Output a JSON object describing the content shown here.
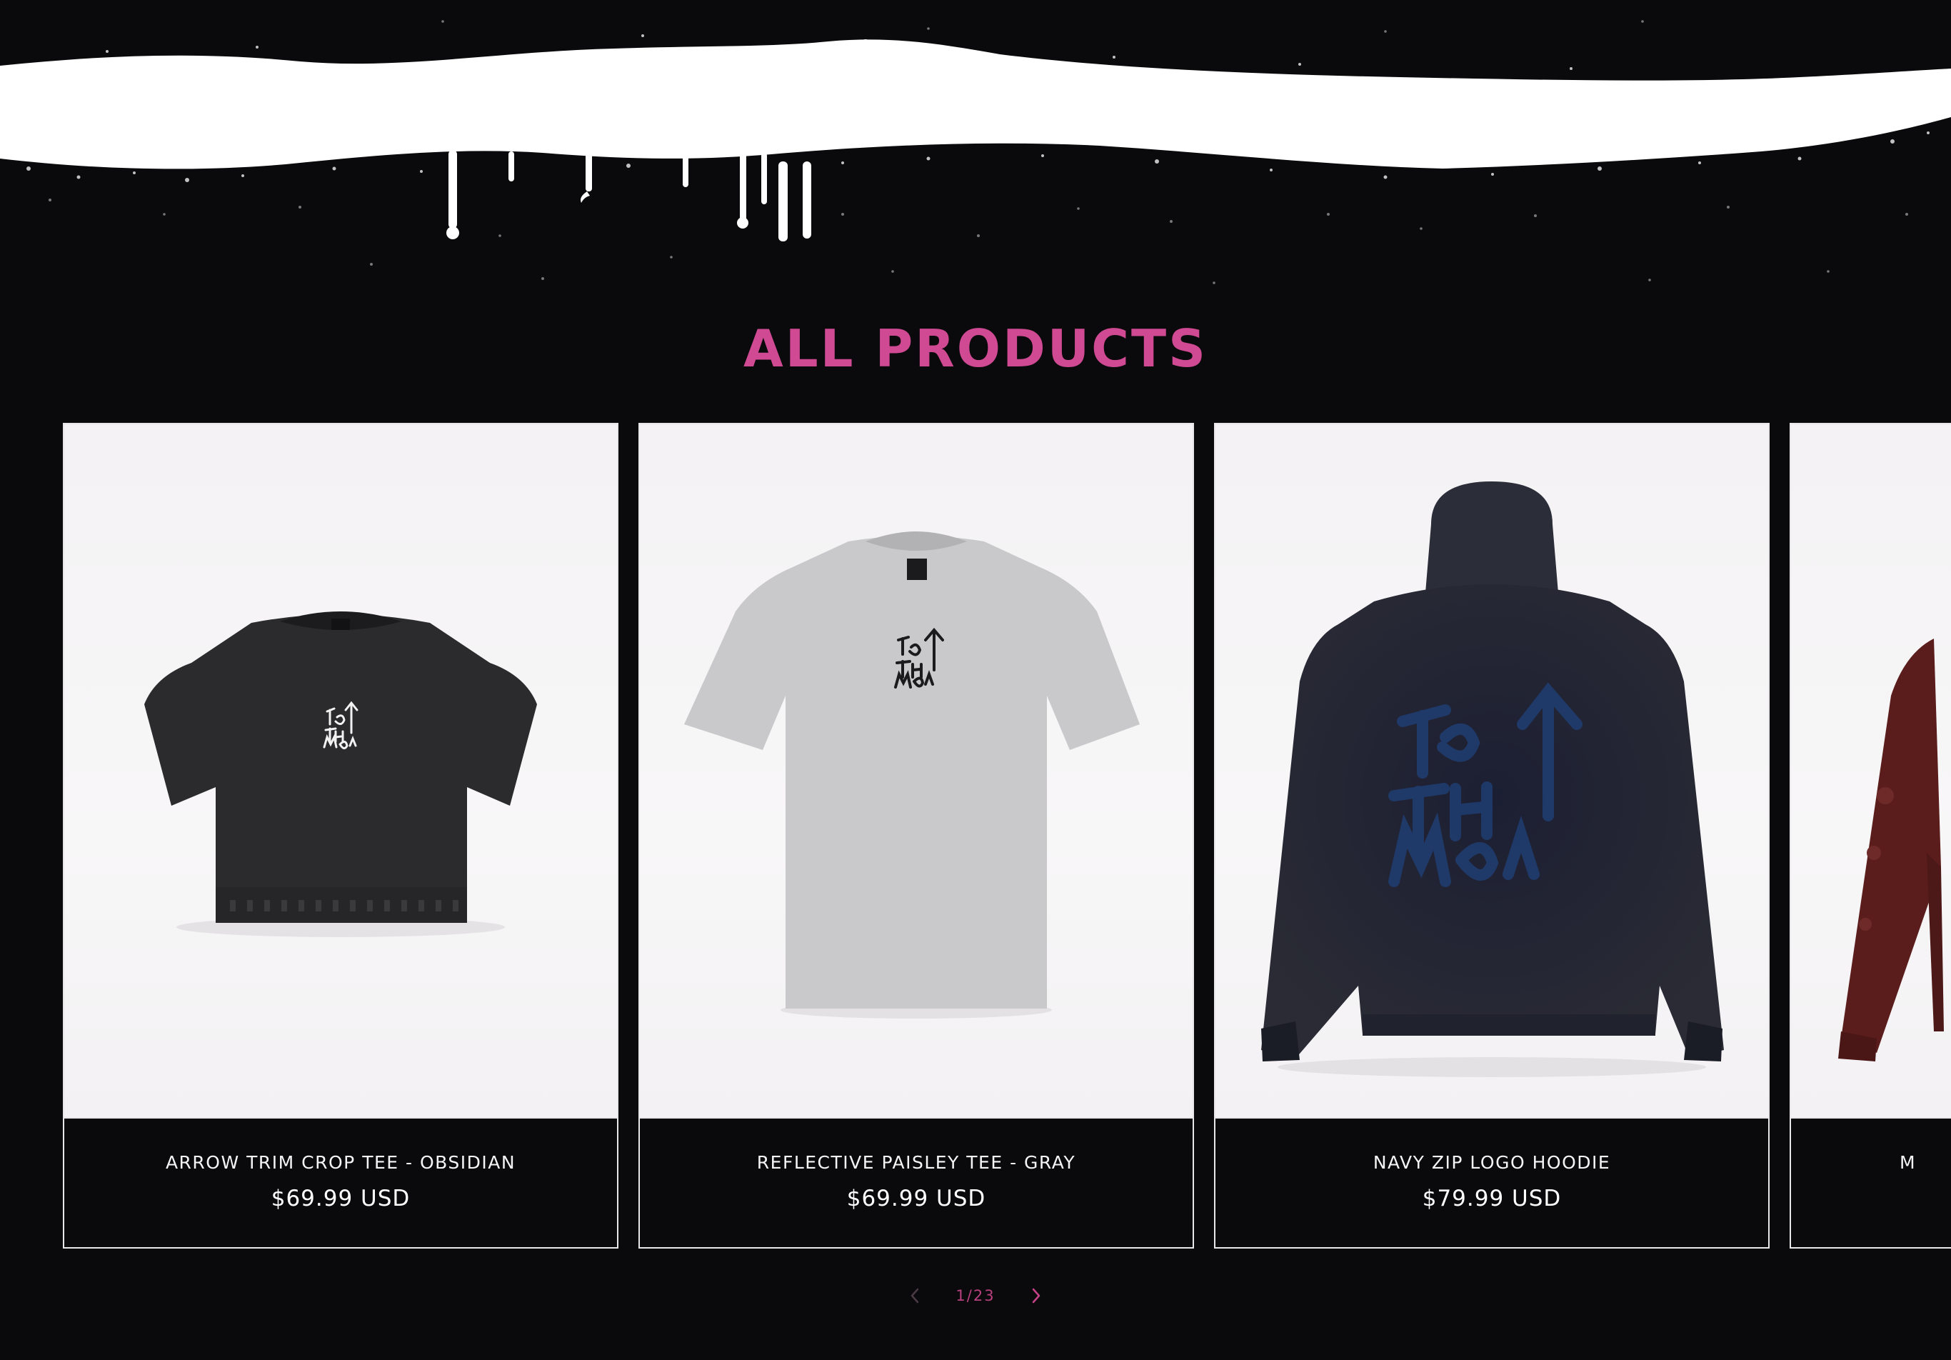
{
  "section": {
    "title": "ALL PRODUCTS"
  },
  "products": [
    {
      "name": "ARROW TRIM CROP TEE - OBSIDIAN",
      "price": "$69.99 USD",
      "image": "black-crop-tee-image"
    },
    {
      "name": "REFLECTIVE PAISLEY TEE - GRAY",
      "price": "$69.99 USD",
      "image": "gray-tee-image"
    },
    {
      "name": "NAVY ZIP LOGO HOODIE",
      "price": "$79.99 USD",
      "image": "navy-hoodie-image"
    },
    {
      "name": "M",
      "price": "",
      "image": "maroon-garment-image"
    }
  ],
  "pagination": {
    "label": "1/23",
    "prev_icon": "chevron-left-icon",
    "next_icon": "chevron-right-icon"
  },
  "colors": {
    "background": "#0a090b",
    "accent": "#cf4a93",
    "card_border": "#e9e6ea",
    "text": "#ffffff"
  }
}
